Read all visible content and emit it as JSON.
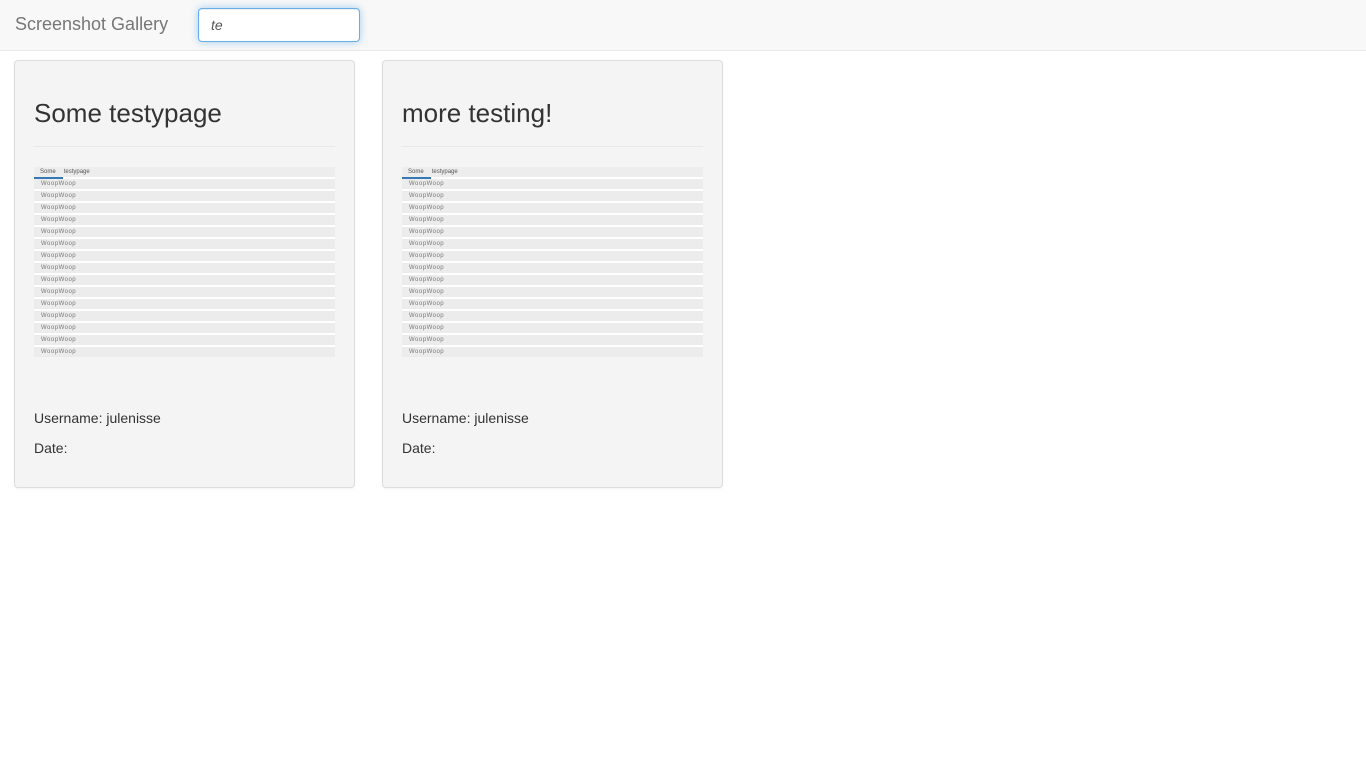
{
  "navbar": {
    "brand": "Screenshot Gallery",
    "search": {
      "value": "te",
      "placeholder": ""
    }
  },
  "cards": [
    {
      "title": "Some testypage",
      "thumbnail": {
        "header_left": "Some",
        "header_right": "testypage",
        "row_text": "WoopWoop",
        "row_count": 15
      },
      "username_label": "Username:",
      "username": "julenisse",
      "date_label": "Date:",
      "date": ""
    },
    {
      "title": "more testing!",
      "thumbnail": {
        "header_left": "Some",
        "header_right": "testypage",
        "row_text": "WoopWoop",
        "row_count": 15
      },
      "username_label": "Username:",
      "username": "julenisse",
      "date_label": "Date:",
      "date": ""
    }
  ],
  "colors": {
    "navbar_bg": "#f8f8f8",
    "card_bg": "#f4f4f4",
    "focus_border": "#66afe9",
    "accent": "#337ab7"
  }
}
